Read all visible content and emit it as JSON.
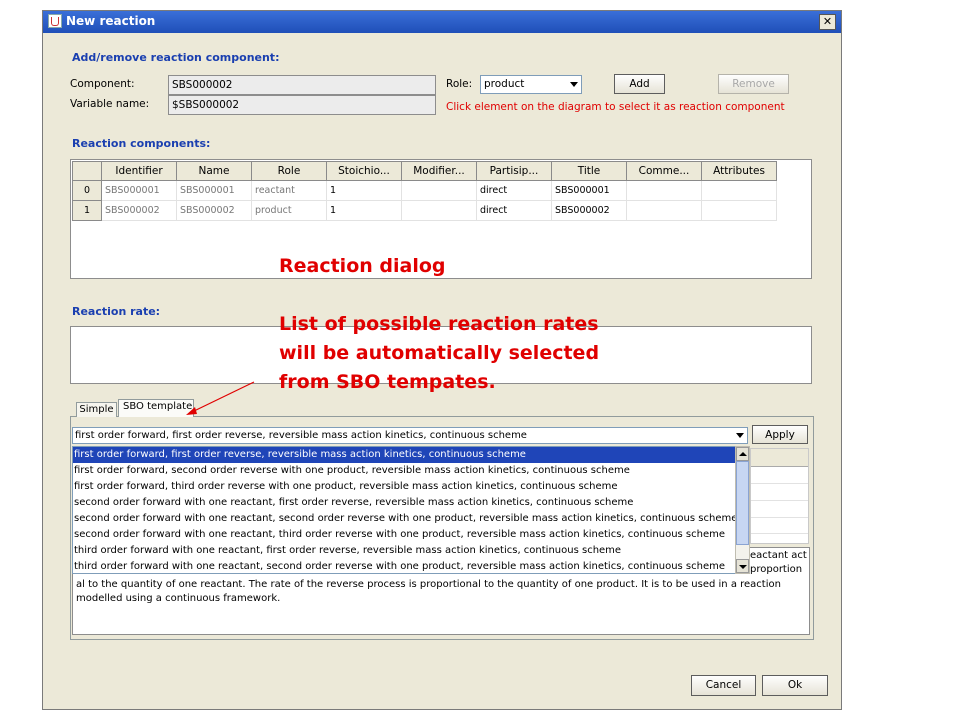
{
  "window": {
    "title": "New reaction",
    "close": "✕"
  },
  "add_section": {
    "heading": "Add/remove reaction component:",
    "component_label": "Component:",
    "component_value": "SBS000002",
    "variable_label": "Variable name:",
    "variable_value": "$SBS000002",
    "role_label": "Role:",
    "role_value": "product",
    "add_label": "Add",
    "remove_label": "Remove",
    "hint": "Click element on the diagram to select it as reaction component"
  },
  "components": {
    "heading": "Reaction components:",
    "columns": [
      "Identifier",
      "Name",
      "Role",
      "Stoichio...",
      "Modifier...",
      "Partisip...",
      "Title",
      "Comme...",
      "Attributes"
    ],
    "rows": [
      {
        "index": "0",
        "cells": [
          "SBS000001",
          "SBS000001",
          "reactant",
          "1",
          "",
          "direct",
          "SBS000001",
          "",
          ""
        ]
      },
      {
        "index": "1",
        "cells": [
          "SBS000002",
          "SBS000002",
          "product",
          "1",
          "",
          "direct",
          "SBS000002",
          "",
          ""
        ]
      }
    ]
  },
  "rate": {
    "heading": "Reaction rate:"
  },
  "tabs": [
    {
      "label": "Simple"
    },
    {
      "label": "SBO template"
    }
  ],
  "template": {
    "selected": "first order forward, first order reverse, reversible mass action kinetics, continuous scheme",
    "apply_label": "Apply",
    "options": [
      "first order forward, first order reverse, reversible mass action kinetics, continuous scheme",
      "first order forward, second order reverse with one product, reversible mass action kinetics, continuous scheme",
      "first order forward, third order reverse with one product, reversible mass action kinetics, continuous scheme",
      "second order forward with one reactant, first order reverse, reversible mass action kinetics, continuous scheme",
      "second order forward with one reactant, second order reverse with one product, reversible mass action kinetics, continuous scheme",
      "second order forward with one reactant, third order reverse with one product, reversible mass action kinetics, continuous scheme",
      "third order forward with one reactant, first order reverse, reversible mass action kinetics, continuous scheme",
      "third order forward with one reactant, second order reverse with one product, reversible mass action kinetics, continuous scheme"
    ],
    "desc_right_1": "eactant act",
    "desc_right_2": "proportion",
    "description": "al to the quantity of one reactant. The rate of the reverse process is proportional to the quantity of one product. It is to be used in a reaction modelled using a continuous framework."
  },
  "footer": {
    "cancel_label": "Cancel",
    "ok_label": "Ok"
  },
  "annotation": {
    "title": "Reaction dialog",
    "line1": "List of possible reaction rates",
    "line2": "will be automatically selected",
    "line3": "from SBO tempates."
  },
  "colors": {
    "annotation": "#e00000",
    "heading": "#1a3fb0",
    "selection": "#1f45b8",
    "titlebar": "#1f4fb8"
  }
}
